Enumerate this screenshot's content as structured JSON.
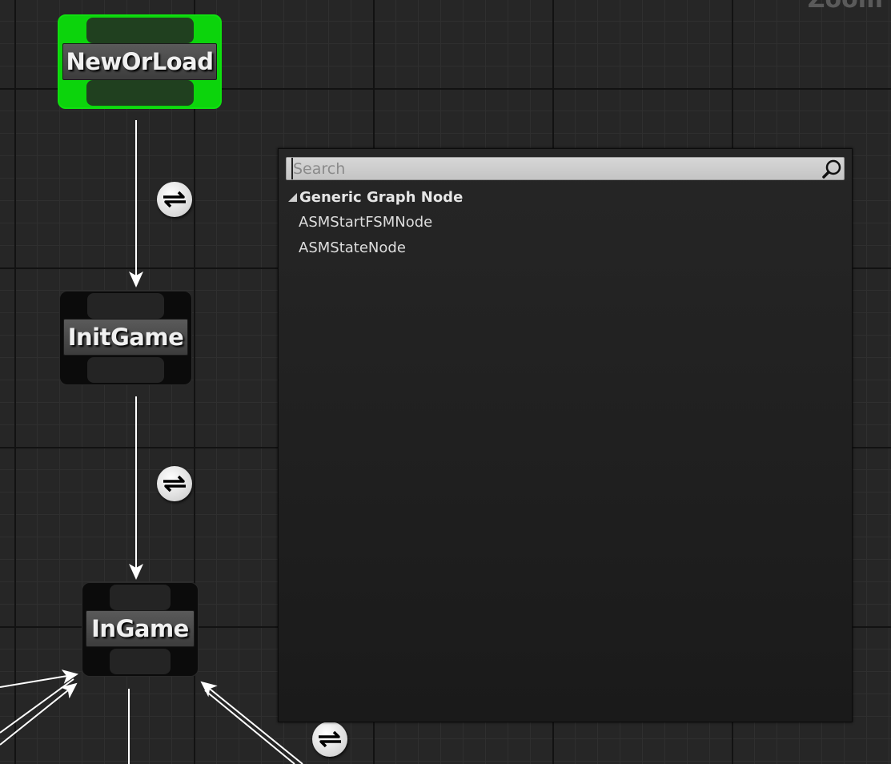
{
  "graph": {
    "zoom_label": "Zoom",
    "nodes": [
      {
        "name": "NewOrLoad",
        "state": "active",
        "color": "#0cd40c"
      },
      {
        "name": "InitGame",
        "state": "inactive",
        "color": "#0b0b0b"
      },
      {
        "name": "InGame",
        "state": "inactive",
        "color": "#0b0b0b"
      }
    ],
    "transition_icon": "transition-arrows-icon",
    "wire_color": "#ffffff"
  },
  "context_menu": {
    "search": {
      "value": "",
      "placeholder": "Search",
      "icon": "magnifier-icon"
    },
    "categories": [
      {
        "label": "Generic Graph Node",
        "expanded": true,
        "items": [
          {
            "label": "ASMStartFSMNode"
          },
          {
            "label": "ASMStateNode"
          }
        ]
      }
    ]
  }
}
